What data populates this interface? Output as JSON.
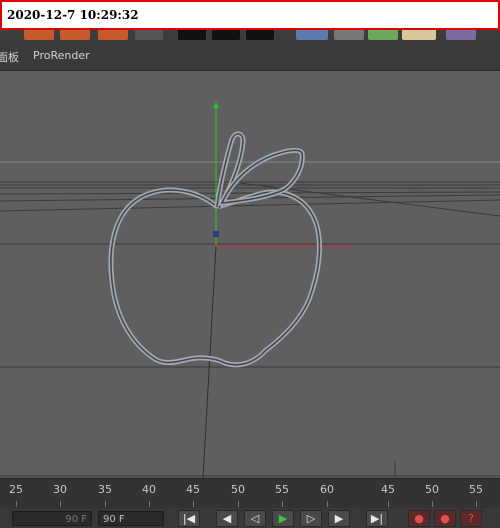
{
  "timestamp": "2020-12-7 10:29:32",
  "menubar": {
    "panel_label": "面板",
    "prorender_label": "ProRender"
  },
  "timeline": {
    "ticks": [
      "25",
      "30",
      "35",
      "40",
      "45",
      "50",
      "55",
      "60",
      "45",
      "50",
      "55"
    ],
    "start_field": "90 F",
    "end_field": "90 F"
  },
  "playback": {
    "buttons": [
      "go-to-start",
      "previous-key",
      "previous-frame",
      "play",
      "next-frame",
      "next-key",
      "go-to-end"
    ]
  },
  "colors": {
    "viewport_bg": "#5f5f5f",
    "axis_y": "#28c828",
    "axis_x": "#c83232",
    "spline": "#3a4a5a",
    "timestamp_border": "#e00000",
    "play_green": "#3cc83c"
  }
}
